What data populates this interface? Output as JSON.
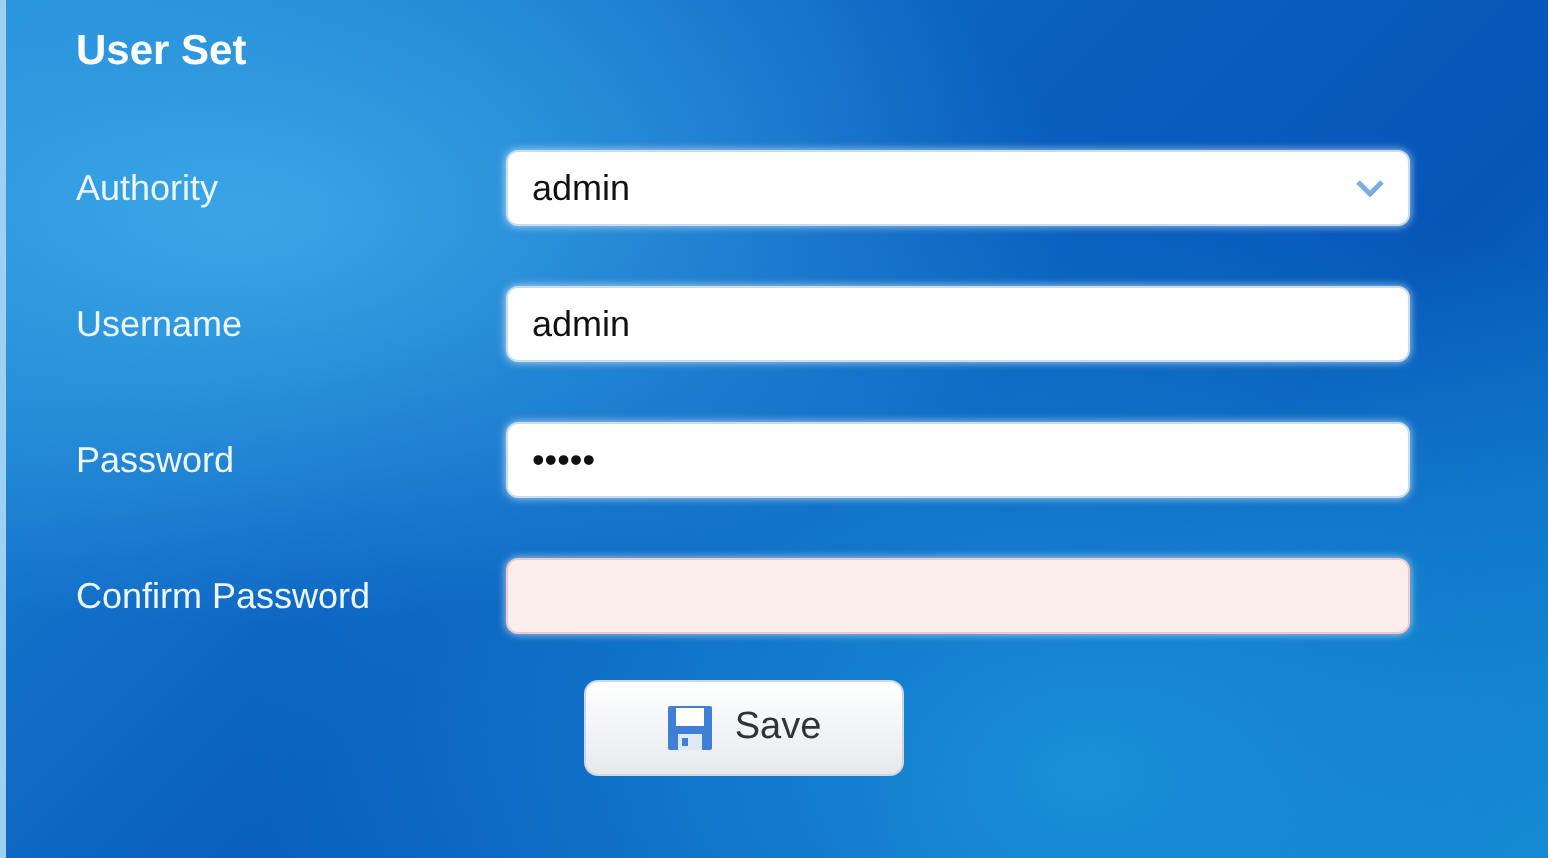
{
  "panel": {
    "title": "User Set"
  },
  "fields": [
    {
      "label": "Authority",
      "kind": "select",
      "value": "admin",
      "invalid": false
    },
    {
      "label": "Username",
      "kind": "text",
      "value": "admin",
      "invalid": false
    },
    {
      "label": "Password",
      "kind": "password",
      "value": "•••••",
      "invalid": false
    },
    {
      "label": "Confirm Password",
      "kind": "password",
      "invalid": true
    }
  ],
  "buttons": [
    {
      "label": "Save",
      "kind": "save"
    }
  ]
}
